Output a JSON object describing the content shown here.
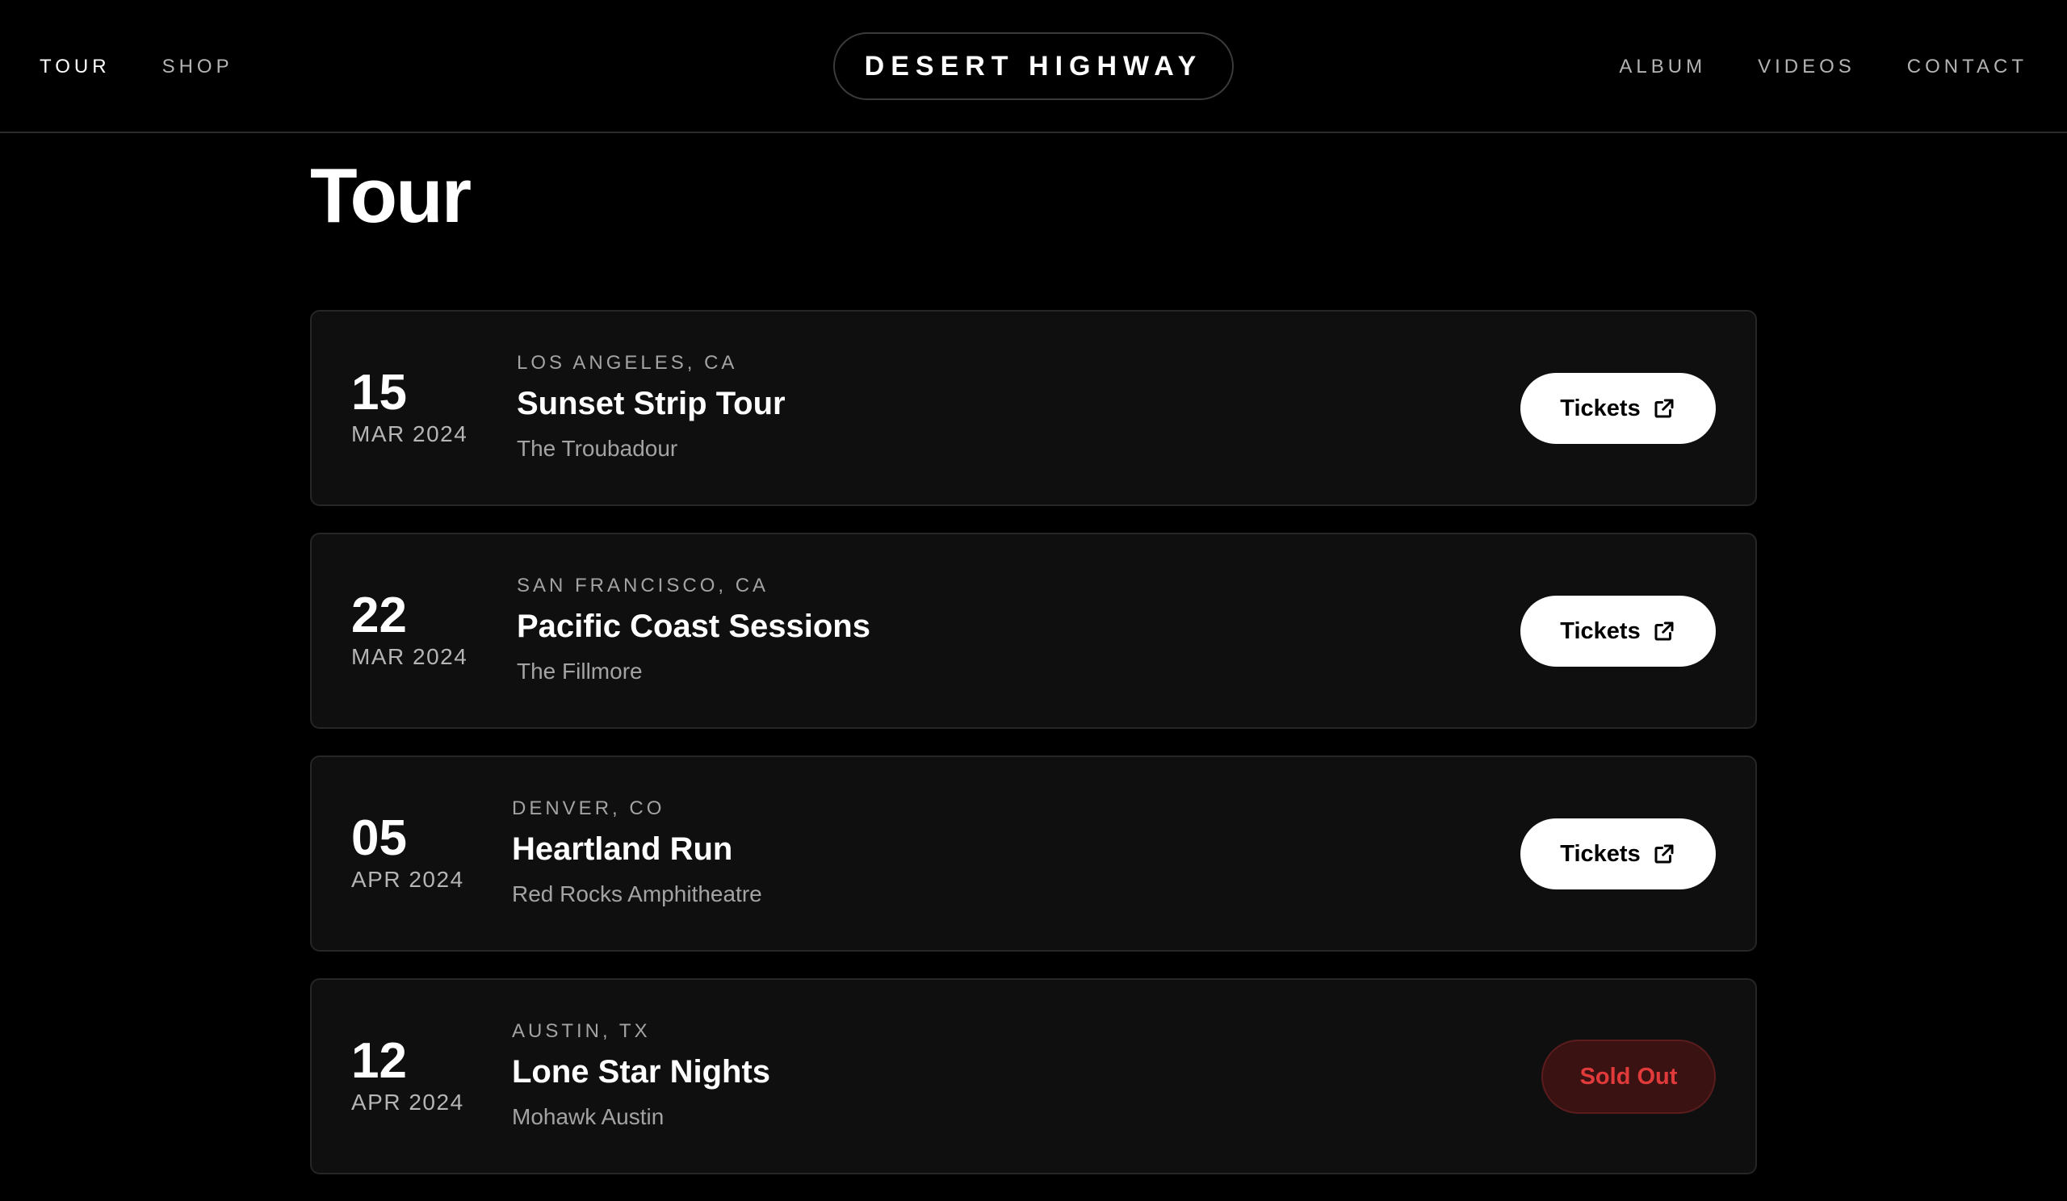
{
  "header": {
    "logo": "DESERT HIGHWAY",
    "nav_left": [
      {
        "label": "TOUR"
      },
      {
        "label": "SHOP"
      }
    ],
    "nav_right": [
      {
        "label": "ALBUM"
      },
      {
        "label": "VIDEOS"
      },
      {
        "label": "CONTACT"
      }
    ]
  },
  "page": {
    "title": "Tour"
  },
  "tour": [
    {
      "day": "15",
      "month": "MAR 2024",
      "location": "LOS ANGELES, CA",
      "name": "Sunset Strip Tour",
      "venue": "The Troubadour",
      "action": "Tickets"
    },
    {
      "day": "22",
      "month": "MAR 2024",
      "location": "SAN FRANCISCO, CA",
      "name": "Pacific Coast Sessions",
      "venue": "The Fillmore",
      "action": "Tickets"
    },
    {
      "day": "05",
      "month": "APR 2024",
      "location": "DENVER, CO",
      "name": "Heartland Run",
      "venue": "Red Rocks Amphitheatre",
      "action": "Tickets"
    },
    {
      "day": "12",
      "month": "APR 2024",
      "location": "AUSTIN, TX",
      "name": "Lone Star Nights",
      "venue": "Mohawk Austin",
      "action": "Sold Out"
    }
  ],
  "icons": {
    "tickets": "external-link-icon"
  },
  "colors": {
    "background": "#000000",
    "card": "#0f0f0f",
    "sold_out_text": "#e03a3a",
    "sold_out_bg": "#3a1212"
  }
}
